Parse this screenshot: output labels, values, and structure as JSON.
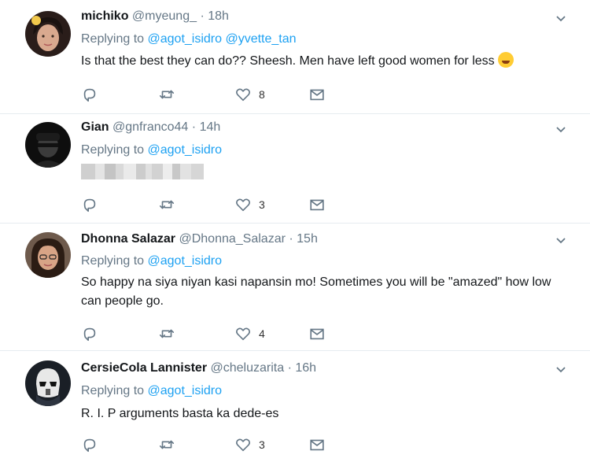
{
  "tweets": [
    {
      "name": "michiko",
      "handle": "@myeung_",
      "dot": "·",
      "time": "18h",
      "reply_prefix": "Replying to",
      "mentions": [
        "@agot_isidro",
        "@yvette_tan"
      ],
      "text": "Is that the best they can do?? Sheesh. Men have left good women for less",
      "emoji": "face-with-tears-of-joy-emoji",
      "reply_count": "",
      "retweet_count": "",
      "like_count": "8"
    },
    {
      "name": "Gian",
      "handle": "@gnfranco44",
      "dot": "·",
      "time": "14h",
      "reply_prefix": "Replying to",
      "mentions": [
        "@agot_isidro"
      ],
      "text": "",
      "reply_count": "",
      "retweet_count": "",
      "like_count": "3"
    },
    {
      "name": "Dhonna Salazar",
      "handle": "@Dhonna_Salazar",
      "dot": "·",
      "time": "15h",
      "reply_prefix": "Replying to",
      "mentions": [
        "@agot_isidro"
      ],
      "text": "So happy na siya niyan kasi napansin mo! Sometimes you will be \"amazed\" how low can people go.",
      "reply_count": "",
      "retweet_count": "",
      "like_count": "4"
    },
    {
      "name": "CersieCola Lannister",
      "handle": "@cheluzarita",
      "dot": "·",
      "time": "16h",
      "reply_prefix": "Replying to",
      "mentions": [
        "@agot_isidro"
      ],
      "text": "R. I. P arguments basta ka dede-es",
      "reply_count": "",
      "retweet_count": "",
      "like_count": "3"
    }
  ],
  "icons": {
    "reply": "reply-icon",
    "retweet": "retweet-icon",
    "like": "heart-icon",
    "dm": "envelope-icon",
    "more": "chevron-down-icon"
  },
  "colors": {
    "link": "#1da1f2",
    "muted": "#657786",
    "text": "#14171a",
    "divider": "#e6ecf0"
  }
}
